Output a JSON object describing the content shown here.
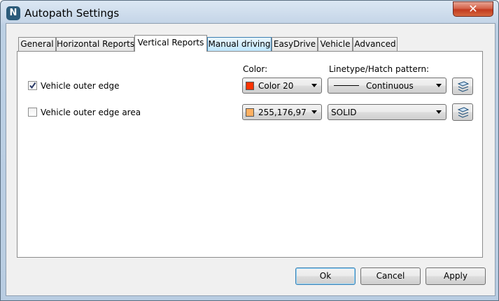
{
  "window": {
    "title": "Autopath Settings",
    "app_icon_letter": "N",
    "close_glyph": "✕"
  },
  "tabs": [
    {
      "label": "General"
    },
    {
      "label": "Horizontal Reports"
    },
    {
      "label": "Vertical Reports"
    },
    {
      "label": "Manual driving"
    },
    {
      "label": "EasyDrive"
    },
    {
      "label": "Vehicle"
    },
    {
      "label": "Advanced"
    }
  ],
  "active_tab": "Vertical Reports",
  "panel": {
    "color_header": "Color:",
    "linetype_header": "Linetype/Hatch pattern:",
    "rows": [
      {
        "label": "Vehicle outer edge",
        "checked": true,
        "color_text": "Color 20",
        "swatch": "#ff3300",
        "linetype": "Continuous"
      },
      {
        "label": "Vehicle outer edge area",
        "checked": false,
        "color_text": "255,176,97",
        "swatch": "#ffb061",
        "linetype": "SOLID"
      }
    ]
  },
  "buttons": {
    "ok": "Ok",
    "cancel": "Cancel",
    "apply": "Apply"
  }
}
